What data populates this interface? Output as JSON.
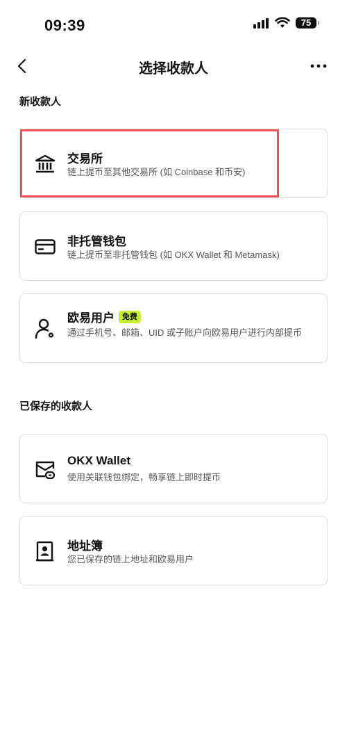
{
  "status_bar": {
    "time": "09:39",
    "battery": "75"
  },
  "header": {
    "title": "选择收款人"
  },
  "sections": {
    "new_recipient": "新收款人",
    "saved_recipient": "已保存的收款人"
  },
  "options": [
    {
      "title": "交易所",
      "desc": "链上提币至其他交易所 (如 Coinbase 和币安)",
      "icon": "bank-icon"
    },
    {
      "title": "非托管钱包",
      "desc": "链上提币至非托管钱包 (如 OKX Wallet 和 Metamask)",
      "icon": "card-icon"
    },
    {
      "title": "欧易用户",
      "badge": "免费",
      "desc": "通过手机号、邮箱、UID 或子账户向欧易用户进行内部提币",
      "icon": "user-gear-icon"
    },
    {
      "title": "OKX Wallet",
      "desc": "使用关联钱包绑定，畅享链上即时提币",
      "icon": "wallet-link-icon"
    },
    {
      "title": "地址簿",
      "desc": "您已保存的链上地址和欧易用户",
      "icon": "address-book-icon"
    }
  ],
  "colors": {
    "highlight": "#ef5058",
    "badge": "#c6f032",
    "border": "#dcdcdc"
  }
}
